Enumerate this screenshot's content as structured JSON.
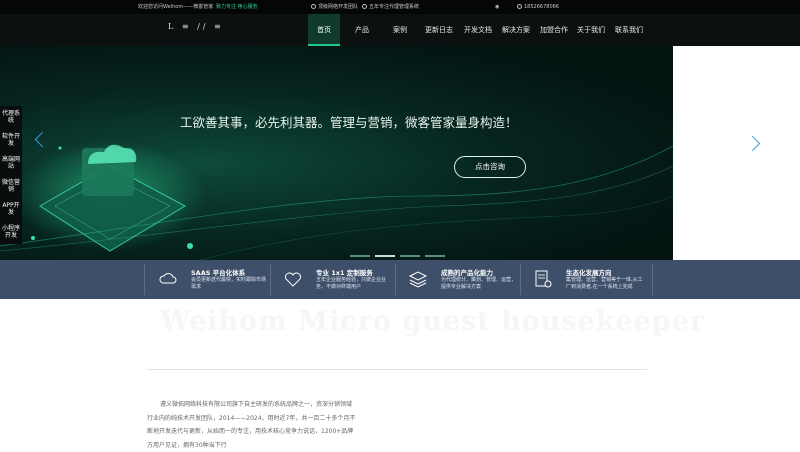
{
  "topbar": {
    "welcome": "欢迎您访问Weihom——微客管家",
    "slogan": "致力专注 用心服务",
    "team": "顶级网络开发团队",
    "years": "五年专注代理管理系统",
    "phone": "18526678066"
  },
  "nav": {
    "logo": "L ≡ ∕∕ ≡",
    "items": [
      "首页",
      "产品",
      "案例",
      "更新日志",
      "开发文档",
      "解决方案",
      "加盟合作",
      "关于我们",
      "联系我们"
    ],
    "active": "首页"
  },
  "hero": {
    "headline": "工欲善其事，必先利其器。管理与营销，微客管家量身构造！",
    "consult_button": "点击咨询",
    "slide_count": 4,
    "active_slide": 1
  },
  "side_menu": [
    "代理系统",
    "软件开发",
    "高端网站",
    "微信营销",
    "APP开发",
    "小程序开发"
  ],
  "features": [
    {
      "icon": "cloud-icon",
      "title": "SAAS 平台化体系",
      "desc": "会员更新迭代最快，实时跟踪市场需求"
    },
    {
      "icon": "heart-shield-icon",
      "title": "专业 1x1 定制服务",
      "desc": "五年企业服务经验，只做企业业务，不做对终端用户"
    },
    {
      "icon": "layers-icon",
      "title": "成熟的产品化能力",
      "desc": "为代理统计、策划、管理、运营，提供专业解决方案"
    },
    {
      "icon": "document-gear-icon",
      "title": "生态化发展方向",
      "desc": "集管理、运营、营销等于一体,从工厂到消费者,在一个系统上完成"
    }
  ],
  "content": {
    "ghost_title": "Weihom Micro guest housekeeper",
    "intro": "遵义微拓网络科技有限公司旗下自主研发的系统品牌之一，资深分销领域行业内的纯技术开发团队，2014——2024，用时近7年，共一百二十多个月不断地开发迭代与更新，从始而一的专注，用技术核心竞争力说话，1200+品牌方用户见证，拥有30种当下行"
  },
  "colors": {
    "accent": "#24c78b",
    "band": "#3e4f6a",
    "arrow": "#3aa0d8"
  }
}
